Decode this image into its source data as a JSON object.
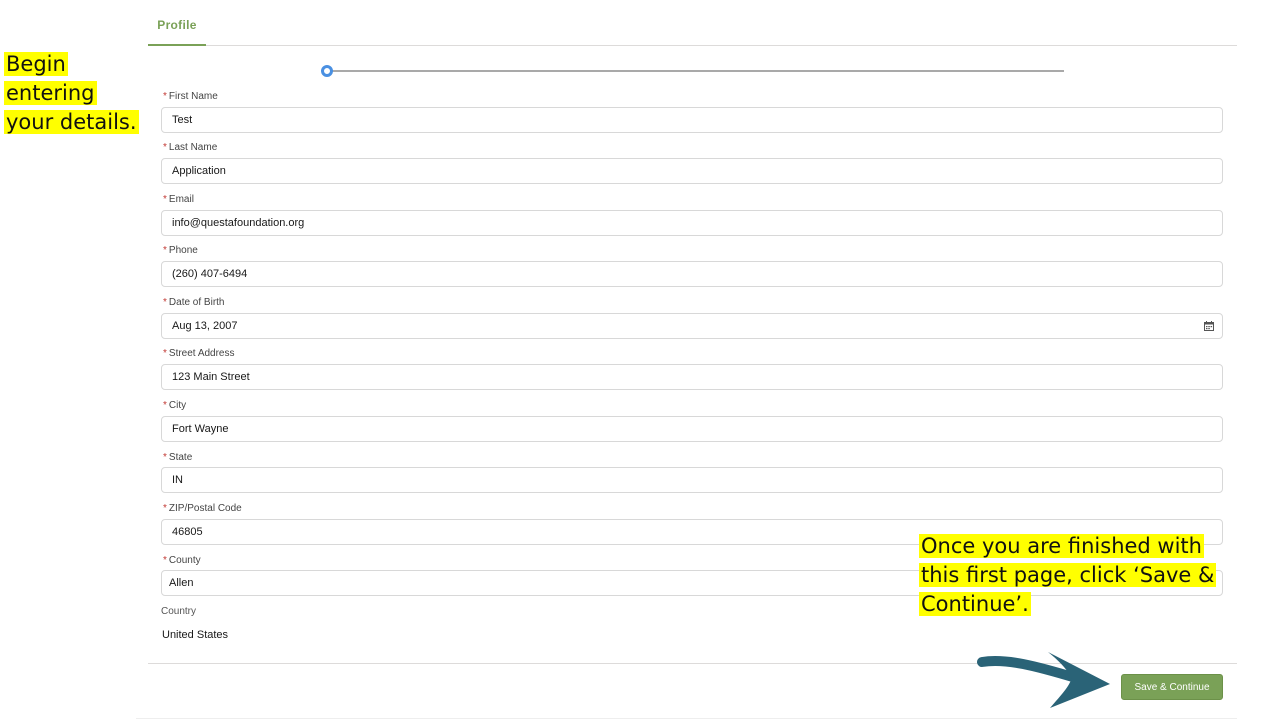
{
  "tabs": [
    {
      "label": "Profile",
      "active": true
    }
  ],
  "progress": {
    "current_step": 1
  },
  "fields": [
    {
      "label": "First Name",
      "value": "Test",
      "required": true
    },
    {
      "label": "Last Name",
      "value": "Application",
      "required": true
    },
    {
      "label": "Email",
      "value": "info@questafoundation.org",
      "required": true
    },
    {
      "label": "Phone",
      "value": "(260) 407-6494",
      "required": true
    },
    {
      "label": "Date of Birth",
      "value": "Aug 13, 2007",
      "required": true,
      "icon": "calendar-icon"
    },
    {
      "label": "Street Address",
      "value": "123 Main Street",
      "required": true
    },
    {
      "label": "City",
      "value": "Fort Wayne",
      "required": true
    },
    {
      "label": "State",
      "value": "IN",
      "required": true
    },
    {
      "label": "ZIP/Postal Code",
      "value": "46805",
      "required": true
    },
    {
      "label": "County",
      "value": "Allen",
      "required": true
    }
  ],
  "required_marker": "*",
  "country": {
    "label": "Country",
    "value": "United States"
  },
  "actions": {
    "save_label": "Save & Continue"
  },
  "annotations": {
    "left": [
      "Begin",
      "entering",
      "your details."
    ],
    "right": [
      "Once you are finished with",
      "this first page, click ‘Save &",
      "Continue’."
    ]
  },
  "colors": {
    "accent": "#7aa157",
    "highlight": "#ffff00",
    "arrow": "#2a6377",
    "progress_dot": "#4a90e2",
    "required": "#c23934"
  }
}
